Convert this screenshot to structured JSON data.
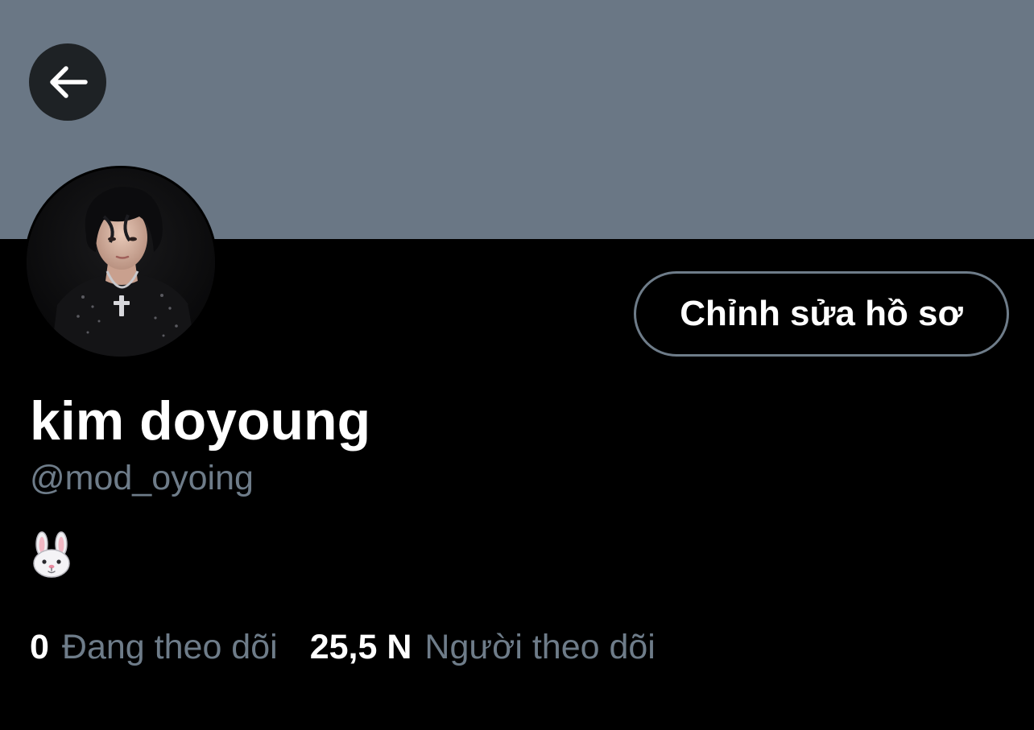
{
  "header": {
    "back_icon": "arrow-left-icon",
    "banner_color": "#6a7785"
  },
  "profile": {
    "avatar_icon": "profile-photo",
    "edit_button_label": "Chỉnh sửa hồ sơ",
    "display_name": "kim doyoung",
    "handle": "@mod_oyoing",
    "bio_emoji": "rabbit-face-emoji"
  },
  "stats": {
    "following": {
      "count": "0",
      "label": "Đang theo dõi"
    },
    "followers": {
      "count": "25,5 N",
      "label": "Người theo dõi"
    }
  },
  "colors": {
    "background": "#000000",
    "secondary_text": "#6e7c89",
    "primary_text": "#ffffff",
    "back_button_bg": "#1e2225"
  }
}
